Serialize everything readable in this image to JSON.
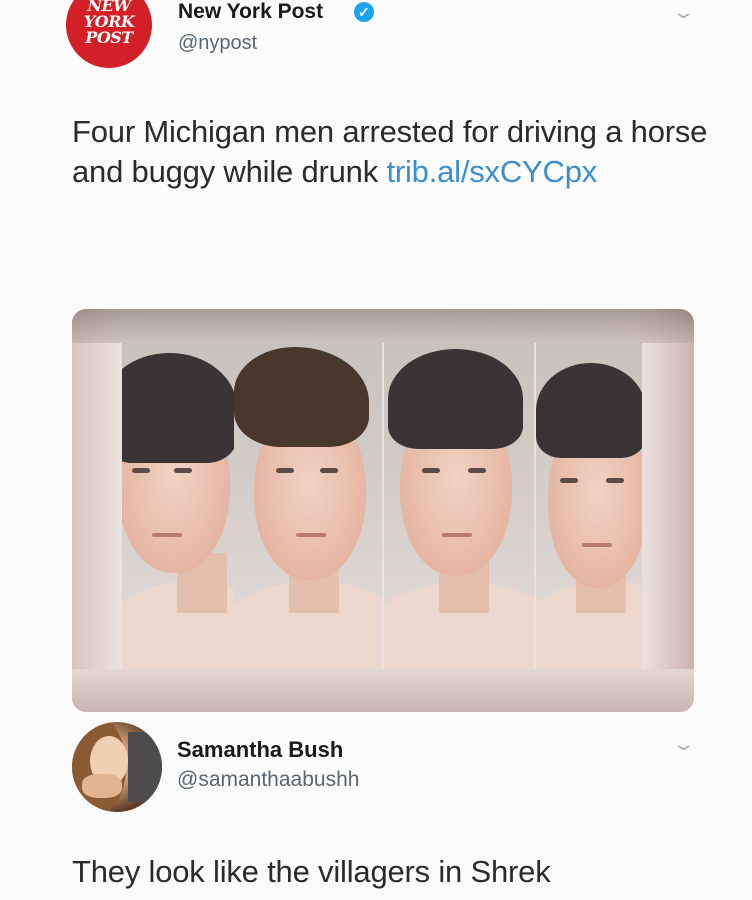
{
  "tweet": {
    "account_logo_text": [
      "NEW",
      "YORK",
      "POST"
    ],
    "display_name": "New York Post",
    "handle": "@nypost",
    "text": "Four Michigan men arrested for driving a horse and buggy while drunk ",
    "link": "trib.al/sxCYCpx",
    "media": {
      "type": "photo",
      "panels": 4
    }
  },
  "reply": {
    "display_name": "Samantha Bush",
    "handle": "@samanthaabushh",
    "text": "They look like the villagers in Shrek"
  },
  "colors": {
    "brand_red": "#d32027",
    "verified_blue": "#1da1f2",
    "link_blue": "#3b8fd1",
    "muted_text": "#5b6670"
  },
  "icons": {
    "verified": "verified-badge-icon",
    "more": "chevron-down-icon"
  }
}
